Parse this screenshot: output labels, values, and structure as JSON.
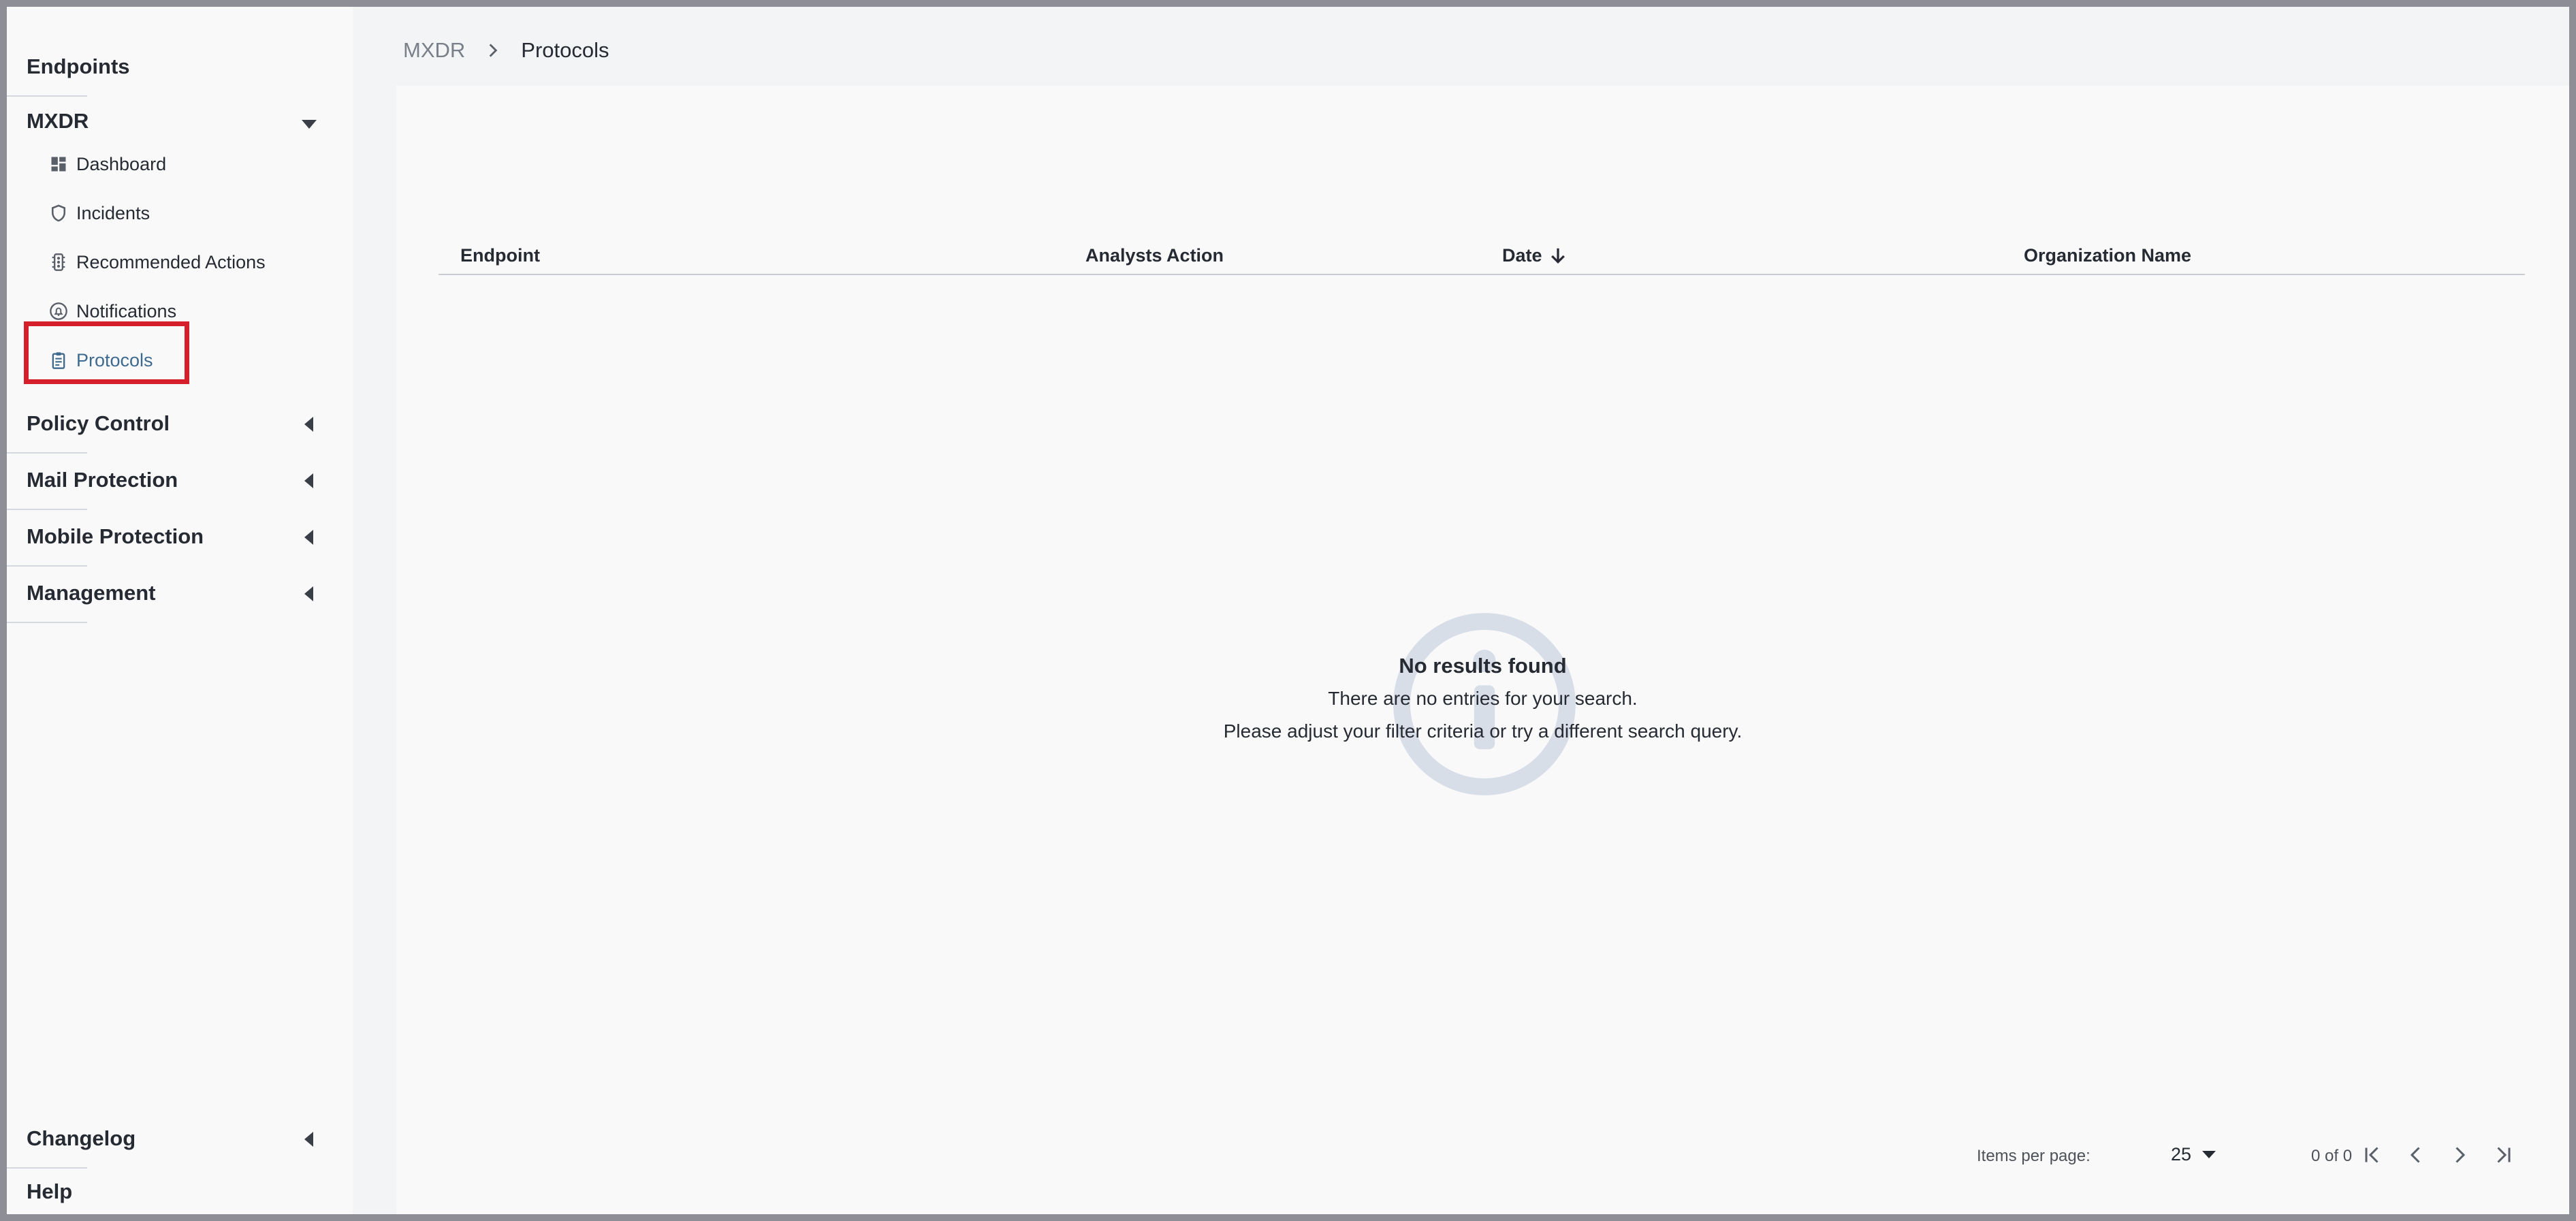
{
  "sidebar": {
    "sections": {
      "endpoints": "Endpoints",
      "mxdr": "MXDR",
      "policy_control": "Policy Control",
      "mail_protection": "Mail Protection",
      "mobile_protection": "Mobile Protection",
      "management": "Management",
      "changelog": "Changelog",
      "help": "Help"
    },
    "mxdr_items": {
      "dashboard": "Dashboard",
      "incidents": "Incidents",
      "recommended_actions": "Recommended Actions",
      "notifications": "Notifications",
      "protocols": "Protocols"
    },
    "icons": {
      "dashboard": "dashboard-icon",
      "incidents": "shield-icon",
      "recommended_actions": "traffic-light-icon",
      "notifications": "bell-circle-icon",
      "protocols": "clipboard-icon"
    },
    "active_item": "Protocols"
  },
  "breadcrumb": {
    "parent": "MXDR",
    "current": "Protocols"
  },
  "table": {
    "columns": [
      "Endpoint",
      "Analysts Action",
      "Date",
      "Organization Name"
    ],
    "sorted_column": "Date",
    "sort_direction": "descending",
    "rows": []
  },
  "empty_state": {
    "title": "No results found",
    "line1": "There are no entries for your search.",
    "line2": "Please adjust your filter criteria or try a different search query."
  },
  "paginator": {
    "items_per_page_label": "Items per page:",
    "items_per_page_value": "25",
    "range_label": "0 of 0"
  },
  "colors": {
    "accent": "#3f6a8f",
    "highlight_border": "#d51f2a",
    "empty_icon": "#d7dee8"
  }
}
